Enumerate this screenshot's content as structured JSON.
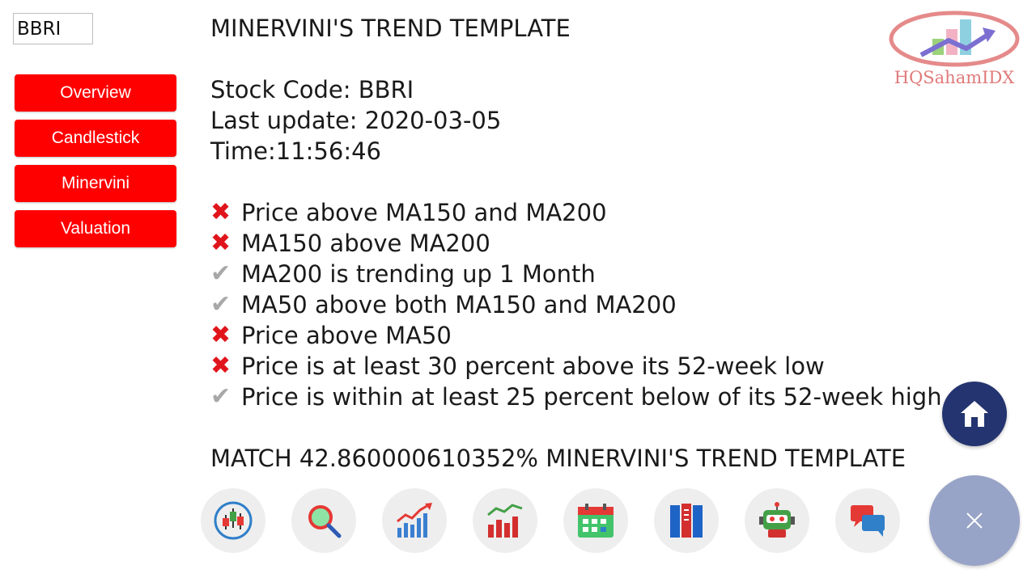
{
  "search": {
    "value": "BBRI"
  },
  "nav": [
    {
      "label": "Overview"
    },
    {
      "label": "Candlestick"
    },
    {
      "label": "Minervini"
    },
    {
      "label": "Valuation"
    }
  ],
  "main": {
    "title": "MINERVINI'S TREND TEMPLATE",
    "stock_code": "Stock Code: BBRI",
    "last_update": "Last update: 2020-03-05",
    "time": "Time:11:56:46",
    "criteria": [
      {
        "status": "fail",
        "icon": "cross-mark-icon",
        "text": "Price above MA150 and MA200"
      },
      {
        "status": "fail",
        "icon": "cross-mark-icon",
        "text": "MA150 above MA200"
      },
      {
        "status": "pass",
        "icon": "check-mark-icon",
        "text": "MA200 is trending up 1 Month"
      },
      {
        "status": "pass",
        "icon": "check-mark-icon",
        "text": "MA50 above both MA150 and MA200"
      },
      {
        "status": "fail",
        "icon": "cross-mark-icon",
        "text": "Price above MA50"
      },
      {
        "status": "fail",
        "icon": "cross-mark-icon",
        "text": "Price is at least 30 percent above its 52-week low"
      },
      {
        "status": "pass",
        "icon": "check-mark-icon",
        "text": "Price is within at least 25 percent below of its 52-week high"
      }
    ],
    "match": "MATCH 42.860000610352% MINERVINI'S TREND TEMPLATE"
  },
  "logo": {
    "text": "HQSahamIDX"
  },
  "fab": {
    "home_icon": "home-icon",
    "close_icon": "close-icon"
  },
  "dock": [
    {
      "icon": "candlestick-chart-icon"
    },
    {
      "icon": "magnifier-icon"
    },
    {
      "icon": "rising-bar-chart-icon"
    },
    {
      "icon": "bar-trend-chart-icon"
    },
    {
      "icon": "calendar-icon"
    },
    {
      "icon": "books-icon"
    },
    {
      "icon": "robot-icon"
    },
    {
      "icon": "chat-bubbles-icon"
    }
  ],
  "colors": {
    "nav_button": "#ff0000",
    "cross": "#e0151c",
    "check": "#a8a8a8",
    "home_fab": "#233470",
    "close_fab": "#97a3c7",
    "logo": "#e07a7a"
  }
}
